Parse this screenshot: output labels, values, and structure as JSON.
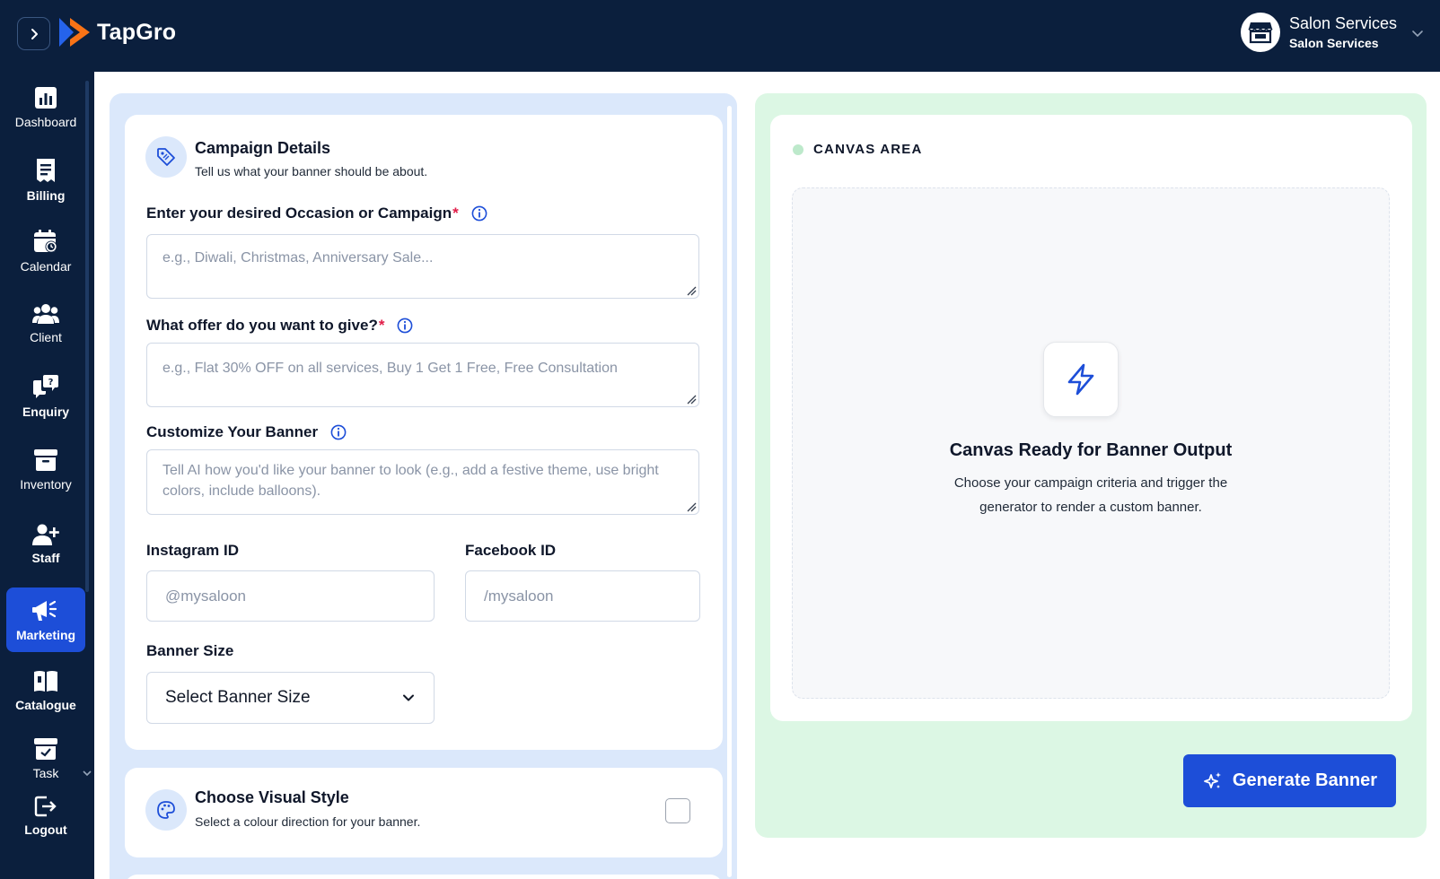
{
  "app": {
    "name": "TapGro"
  },
  "account": {
    "name": "Salon Services",
    "subtitle": "Salon Services"
  },
  "sidebar": {
    "items": [
      {
        "label": "Dashboard",
        "icon": "dashboard-icon"
      },
      {
        "label": "Billing",
        "icon": "billing-icon"
      },
      {
        "label": "Calendar",
        "icon": "calendar-icon"
      },
      {
        "label": "Client",
        "icon": "client-icon"
      },
      {
        "label": "Enquiry",
        "icon": "enquiry-icon"
      },
      {
        "label": "Inventory",
        "icon": "inventory-icon"
      },
      {
        "label": "Staff",
        "icon": "staff-icon"
      },
      {
        "label": "Marketing",
        "icon": "marketing-icon",
        "active": true
      },
      {
        "label": "Catalogue",
        "icon": "catalogue-icon"
      },
      {
        "label": "Task",
        "icon": "task-icon"
      },
      {
        "label": "Logout",
        "icon": "logout-icon"
      }
    ]
  },
  "campaign": {
    "title": "Campaign Details",
    "subtitle": "Tell us what your banner should be about.",
    "occasion": {
      "label": "Enter your desired Occasion or Campaign",
      "required": "*",
      "placeholder": "e.g., Diwali, Christmas, Anniversary Sale..."
    },
    "offer": {
      "label": "What offer do you want to give?",
      "required": "*",
      "placeholder": "e.g., Flat 30% OFF on all services, Buy 1 Get 1 Free, Free Consultation"
    },
    "customize": {
      "label": "Customize Your Banner",
      "placeholder": "Tell AI how you'd like your banner to look (e.g., add a festive theme, use bright colors, include balloons)."
    },
    "instagram": {
      "label": "Instagram ID",
      "placeholder": "@mysaloon"
    },
    "facebook": {
      "label": "Facebook ID",
      "placeholder": "/mysaloon"
    },
    "banner_size": {
      "label": "Banner Size",
      "value": "Select Banner Size"
    }
  },
  "visual_style": {
    "title": "Choose Visual Style",
    "subtitle": "Select a colour direction for your banner."
  },
  "canvas": {
    "label": "CANVAS AREA",
    "heading": "Canvas Ready for Banner Output",
    "description": "Choose your campaign criteria and trigger the generator to render a custom banner."
  },
  "generate_button": {
    "label": "Generate Banner"
  },
  "colors": {
    "nav_bg": "#0b1f3d",
    "accent": "#1d4ed8",
    "left_panel_bg": "#dbe8fb",
    "right_panel_bg": "#dcf7e4",
    "required": "#e11d48"
  }
}
